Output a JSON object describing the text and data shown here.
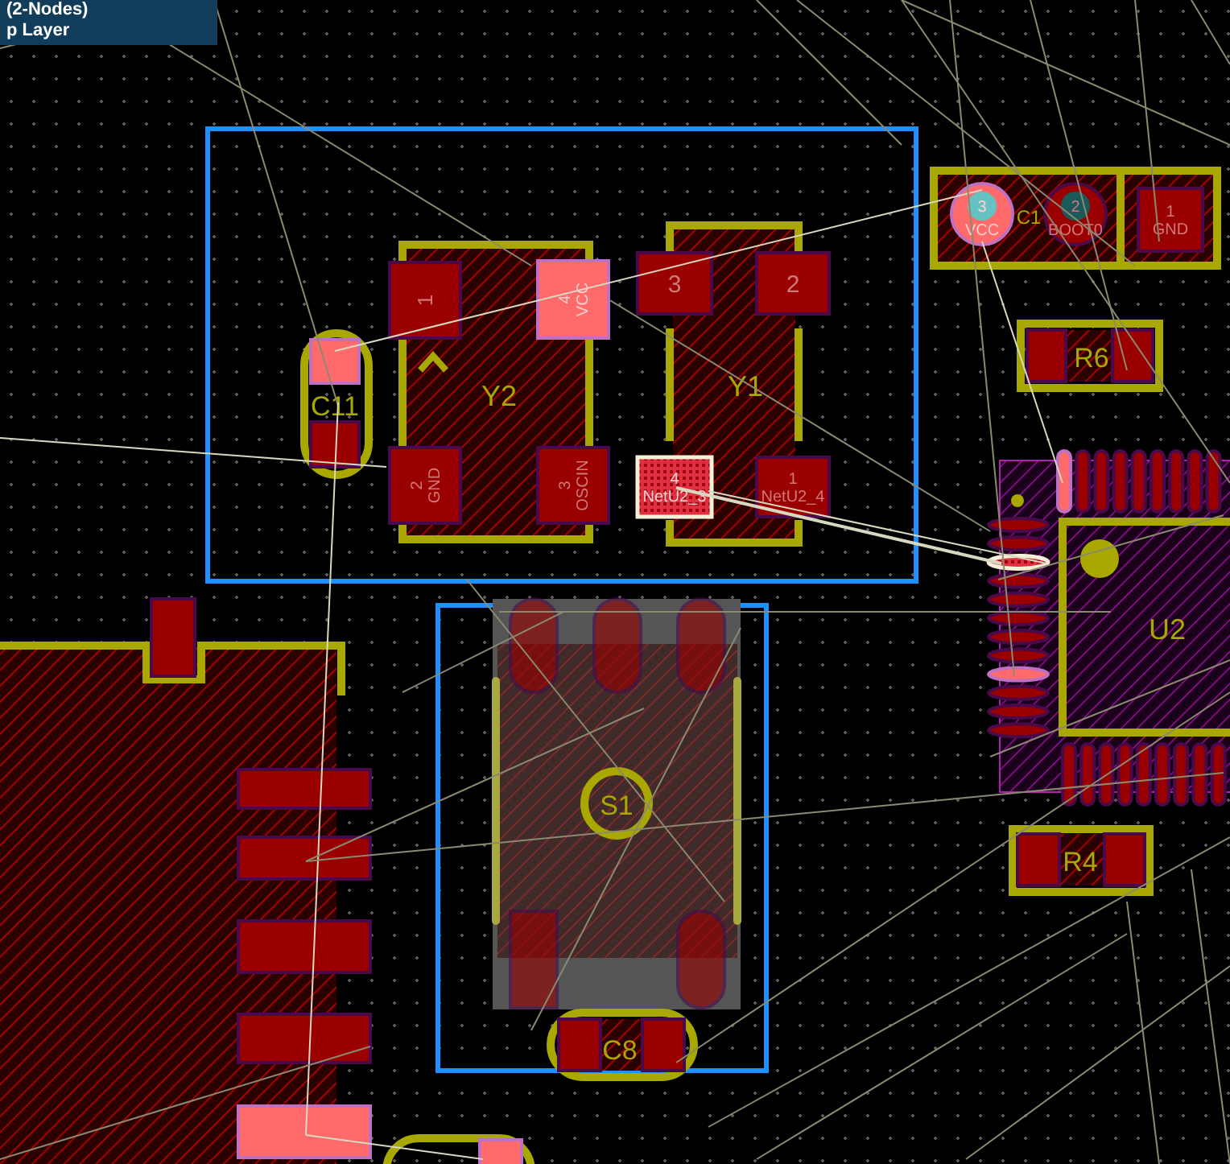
{
  "info_box": {
    "lines": [
      "(2-Nodes)",
      "p Layer"
    ]
  },
  "components": [
    {
      "designator": "C11",
      "pads": [
        {
          "highlighted": true,
          "selected": false
        },
        {
          "highlighted": false,
          "selected": false
        }
      ]
    },
    {
      "designator": "Y2",
      "pads": [
        {
          "number": "1",
          "highlighted": false,
          "selected": false
        },
        {
          "number": "4",
          "net": "VCC",
          "highlighted": true,
          "selected": false
        },
        {
          "number": "2",
          "net": "GND",
          "highlighted": false,
          "selected": false
        },
        {
          "number": "3",
          "net": "OSCIN",
          "highlighted": false,
          "selected": false
        }
      ]
    },
    {
      "designator": "Y1",
      "pads": [
        {
          "number": "3",
          "highlighted": false,
          "selected": false
        },
        {
          "number": "2",
          "highlighted": false,
          "selected": false
        },
        {
          "number": "4",
          "net": "NetU2_3",
          "highlighted": false,
          "selected": true
        },
        {
          "number": "1",
          "net": "NetU2_4",
          "highlighted": false,
          "selected": false
        }
      ]
    },
    {
      "designator": "C1",
      "pads": [
        {
          "number": "3",
          "net": "VCC",
          "highlighted": true,
          "selected": false
        },
        {
          "number": "2",
          "net": "BOOT0",
          "highlighted": false,
          "selected": false
        },
        {
          "number": "1",
          "net": "GND",
          "highlighted": false,
          "selected": false
        }
      ]
    },
    {
      "designator": "R6",
      "pads": [
        {
          "highlighted": false,
          "selected": false
        },
        {
          "highlighted": false,
          "selected": false
        }
      ]
    },
    {
      "designator": "U2",
      "left_pins": [
        {
          "highlighted": false,
          "selected": false
        },
        {
          "highlighted": false,
          "selected": false
        },
        {
          "highlighted": false,
          "selected": true
        },
        {
          "highlighted": false,
          "selected": false
        },
        {
          "highlighted": false,
          "selected": false
        },
        {
          "highlighted": false,
          "selected": false
        },
        {
          "highlighted": false,
          "selected": false
        },
        {
          "highlighted": false,
          "selected": false
        },
        {
          "highlighted": true,
          "selected": false
        },
        {
          "highlighted": false,
          "selected": false
        },
        {
          "highlighted": false,
          "selected": false
        },
        {
          "highlighted": false,
          "selected": false
        }
      ],
      "top_pins": [
        {
          "highlighted": true,
          "selected": false
        },
        {
          "highlighted": false,
          "selected": false
        },
        {
          "highlighted": false,
          "selected": false
        },
        {
          "highlighted": false,
          "selected": false
        },
        {
          "highlighted": false,
          "selected": false
        },
        {
          "highlighted": false,
          "selected": false
        },
        {
          "highlighted": false,
          "selected": false
        },
        {
          "highlighted": false,
          "selected": false
        },
        {
          "highlighted": false,
          "selected": false
        }
      ],
      "bottom_pins": [
        {
          "highlighted": false,
          "selected": false
        },
        {
          "highlighted": false,
          "selected": false
        },
        {
          "highlighted": false,
          "selected": false
        },
        {
          "highlighted": false,
          "selected": false
        },
        {
          "highlighted": false,
          "selected": false
        },
        {
          "highlighted": false,
          "selected": false
        },
        {
          "highlighted": false,
          "selected": false
        },
        {
          "highlighted": false,
          "selected": false
        },
        {
          "highlighted": false,
          "selected": false
        }
      ]
    },
    {
      "designator": "R4",
      "pads": [
        {
          "highlighted": false,
          "selected": false
        },
        {
          "highlighted": false,
          "selected": false
        }
      ]
    },
    {
      "designator": "S1",
      "pads": [
        {
          "highlighted": false,
          "selected": false
        },
        {
          "highlighted": false,
          "selected": false
        },
        {
          "highlighted": false,
          "selected": false
        },
        {
          "highlighted": false,
          "selected": false
        },
        {
          "highlighted": false,
          "selected": false
        }
      ]
    },
    {
      "designator": "C8",
      "pads": [
        {
          "highlighted": false,
          "selected": false
        },
        {
          "highlighted": false,
          "selected": false
        }
      ]
    },
    {
      "pads": [
        {
          "highlighted": false,
          "selected": false
        },
        {
          "highlighted": false,
          "selected": false
        },
        {
          "highlighted": false,
          "selected": false
        },
        {
          "highlighted": false,
          "selected": false
        },
        {
          "highlighted": false,
          "selected": false
        },
        {
          "highlighted": true,
          "selected": false
        }
      ]
    },
    {
      "pads": [
        {
          "highlighted": true,
          "selected": false
        }
      ]
    }
  ]
}
